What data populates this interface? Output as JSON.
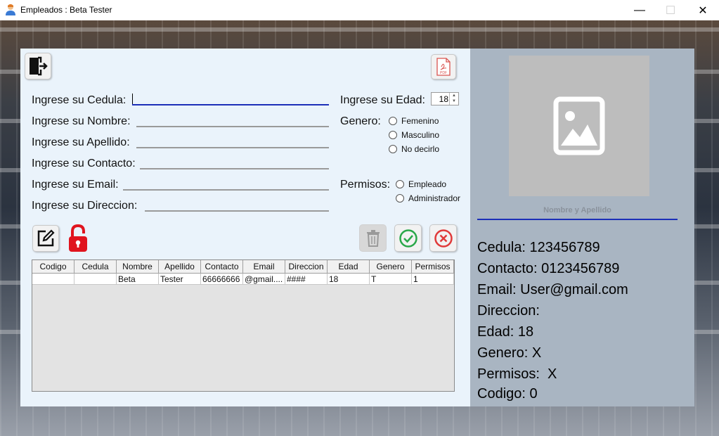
{
  "window": {
    "title": "Empleados : Beta Tester",
    "minimize": "—",
    "maximize": "☐",
    "close": "✕"
  },
  "form": {
    "cedula_label": "Ingrese su Cedula:",
    "nombre_label": "Ingrese su Nombre:",
    "apellido_label": "Ingrese su Apellido:",
    "contacto_label": "Ingrese su Contacto:",
    "email_label": "Ingrese su Email:",
    "direccion_label": "Ingrese su Direccion:",
    "edad_label": "Ingrese su Edad:",
    "edad_value": "18",
    "genero_label": "Genero:",
    "genero_options": [
      "Femenino",
      "Masculino",
      "No decirlo"
    ],
    "permisos_label": "Permisos:",
    "permisos_options": [
      "Empleado",
      "Administrador"
    ]
  },
  "table": {
    "headers": [
      "Codigo",
      "Cedula",
      "Nombre",
      "Apellido",
      "Contacto",
      "Email",
      "Direccion",
      "Edad",
      "Genero",
      "Permisos"
    ],
    "rows": [
      [
        "",
        "",
        "Beta",
        "Tester",
        "66666666",
        "@gmail....",
        "####",
        "18",
        "T",
        "1"
      ]
    ]
  },
  "profile": {
    "name_label": "Nombre y Apellido",
    "cedula": "Cedula: 123456789",
    "contacto": "Contacto: 0123456789",
    "email": "Email: User@gmail.com",
    "direccion": "Direccion:",
    "edad": "Edad: 18",
    "genero": "Genero: X",
    "permisos": "Permisos:  X",
    "codigo": "Codigo: 0"
  },
  "icons": {
    "exit": "exit-door-icon",
    "pdf": "pdf-icon",
    "edit": "edit-icon",
    "lock": "unlock-icon",
    "delete": "trash-icon",
    "confirm": "check-circle-icon",
    "cancel": "x-circle-icon",
    "placeholder": "image-placeholder-icon"
  },
  "colors": {
    "left_panel": "#eaf3fb",
    "right_panel": "#a9b5c2",
    "focus_line": "#1c2fb8",
    "lock_red": "#e0141e",
    "confirm_green": "#2aa84a",
    "cancel_red": "#e03a3a"
  }
}
